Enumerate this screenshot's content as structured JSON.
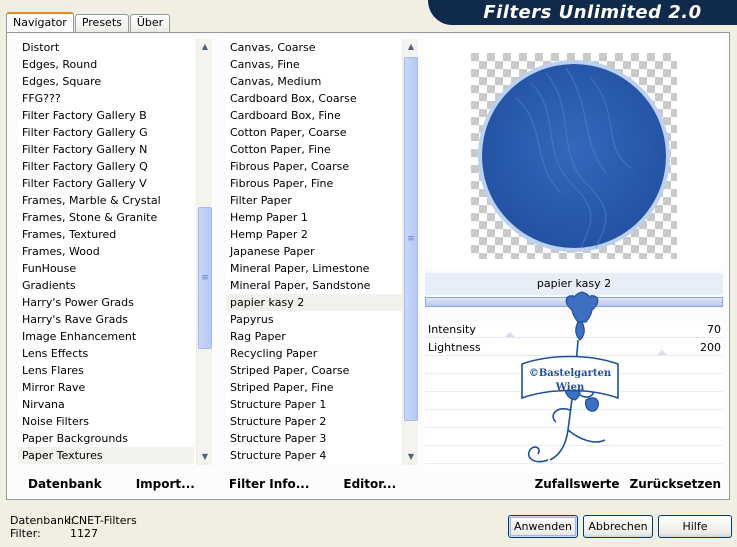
{
  "tabs": [
    {
      "label": "Navigator",
      "active": true
    },
    {
      "label": "Presets",
      "active": false
    },
    {
      "label": "Über",
      "active": false
    }
  ],
  "banner_title": "Filters Unlimited 2.0",
  "categories": [
    "Distort",
    "Edges, Round",
    "Edges, Square",
    "FFG???",
    "Filter Factory Gallery B",
    "Filter Factory Gallery G",
    "Filter Factory Gallery N",
    "Filter Factory Gallery Q",
    "Filter Factory Gallery V",
    "Frames, Marble & Crystal",
    "Frames, Stone & Granite",
    "Frames, Textured",
    "Frames, Wood",
    "FunHouse",
    "Gradients",
    "Harry's Power Grads",
    "Harry's Rave Grads",
    "Image Enhancement",
    "Lens Effects",
    "Lens Flares",
    "Mirror Rave",
    "Nirvana",
    "Noise Filters",
    "Paper Backgrounds",
    "Paper Textures"
  ],
  "selected_category": "Paper Textures",
  "filters": [
    "Canvas, Coarse",
    "Canvas, Fine",
    "Canvas, Medium",
    "Cardboard Box, Coarse",
    "Cardboard Box, Fine",
    "Cotton Paper, Coarse",
    "Cotton Paper, Fine",
    "Fibrous Paper, Coarse",
    "Fibrous Paper, Fine",
    "Filter Paper",
    "Hemp Paper 1",
    "Hemp Paper 2",
    "Japanese Paper",
    "Mineral Paper, Limestone",
    "Mineral Paper, Sandstone",
    "papier kasy 2",
    "Papyrus",
    "Rag Paper",
    "Recycling Paper",
    "Striped Paper, Coarse",
    "Striped Paper, Fine",
    "Structure Paper 1",
    "Structure Paper 2",
    "Structure Paper 3",
    "Structure Paper 4"
  ],
  "selected_filter": "papier kasy 2",
  "left_links": {
    "database": "Datenbank",
    "import": "Import...",
    "filter_info": "Filter Info...",
    "editor": "Editor..."
  },
  "current_filter_name": "papier kasy 2",
  "controls": [
    {
      "label": "Intensity",
      "value": "70"
    },
    {
      "label": "Lightness",
      "value": "200"
    }
  ],
  "logo_text": {
    "line1": "©Bastelgarten",
    "line2": "Wien"
  },
  "right_links": {
    "randomize": "Zufallswerte",
    "reset": "Zurücksetzen"
  },
  "footer": {
    "database_label": "Datenbank:",
    "database_value": "ICNET-Filters",
    "filter_label": "Filter:",
    "filter_value": "1127"
  },
  "buttons": {
    "apply": "Anwenden",
    "cancel": "Abbrechen",
    "help": "Hilfe"
  },
  "colors": {
    "preview_blue": "#2f5fb0",
    "banner_bg": "#0f2a4a",
    "logo_blue": "#2a5aa8"
  }
}
